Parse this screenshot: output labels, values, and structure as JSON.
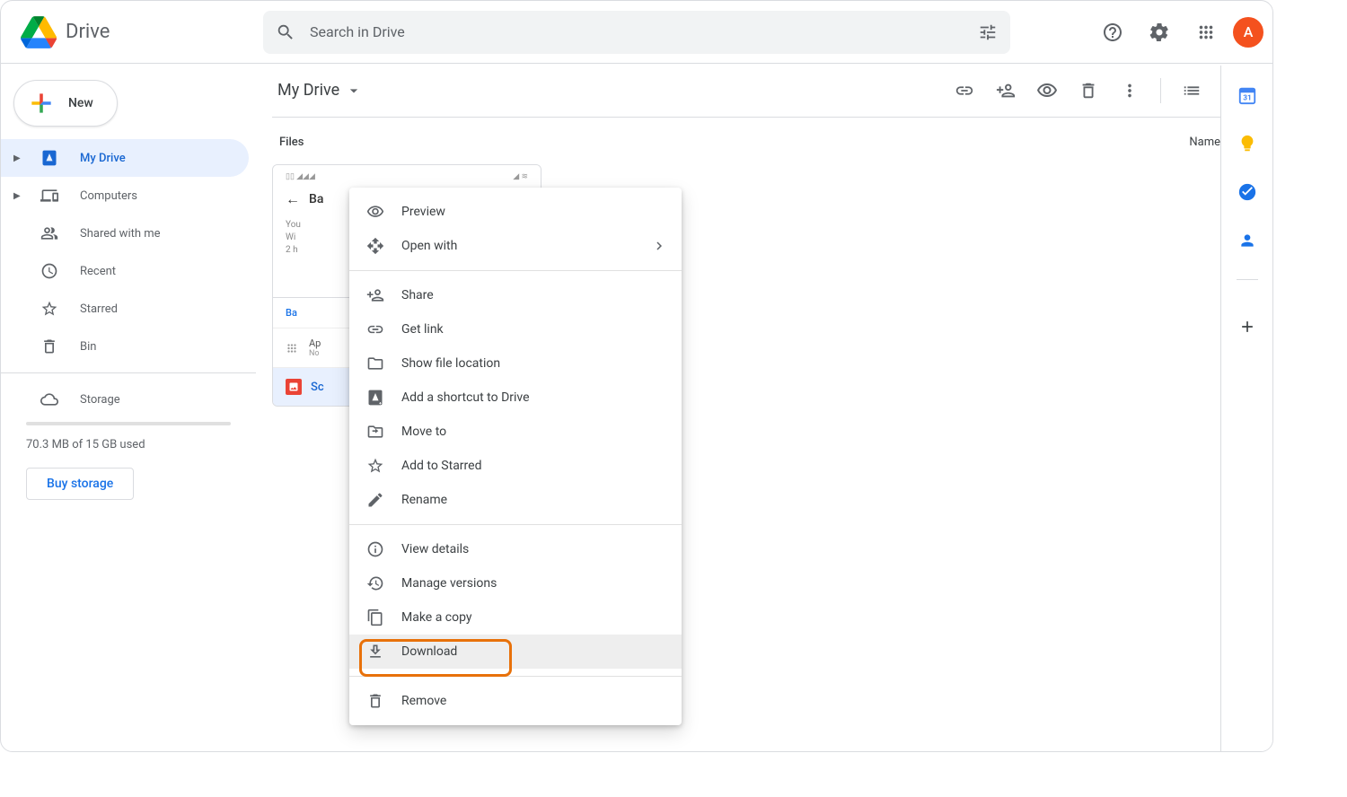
{
  "app": {
    "title": "Drive"
  },
  "search": {
    "placeholder": "Search in Drive"
  },
  "header": {
    "avatar_initial": "A"
  },
  "sidebar": {
    "new_label": "New",
    "items": [
      {
        "label": "My Drive"
      },
      {
        "label": "Computers"
      },
      {
        "label": "Shared with me"
      },
      {
        "label": "Recent"
      },
      {
        "label": "Starred"
      },
      {
        "label": "Bin"
      }
    ],
    "storage_label": "Storage",
    "storage_used": "70.3 MB of 15 GB used",
    "buy_label": "Buy storage"
  },
  "toolbar": {
    "breadcrumb": "My Drive"
  },
  "content": {
    "files_label": "Files",
    "sort_label": "Name",
    "card": {
      "pv_back": "Ba",
      "pv_you": "You",
      "pv_wi": "Wi",
      "pv_2h": "2 h",
      "mid": "Ba",
      "app_label": "Ap",
      "app_sub": "No",
      "filename": "Sc"
    }
  },
  "context_menu": {
    "preview": "Preview",
    "open_with": "Open with",
    "share": "Share",
    "get_link": "Get link",
    "show_location": "Show file location",
    "add_shortcut": "Add a shortcut to Drive",
    "move_to": "Move to",
    "add_starred": "Add to Starred",
    "rename": "Rename",
    "view_details": "View details",
    "manage_versions": "Manage versions",
    "make_copy": "Make a copy",
    "download": "Download",
    "remove": "Remove"
  }
}
